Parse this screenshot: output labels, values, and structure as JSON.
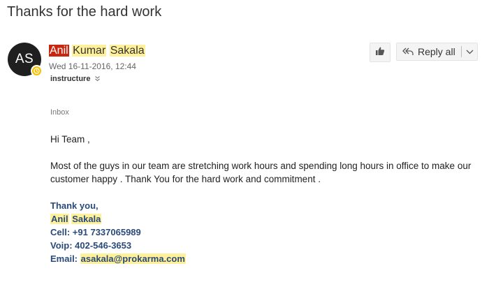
{
  "subject": "Thanks for the hard work",
  "avatar": {
    "initials": "AS",
    "presence_color": "#f8c200"
  },
  "sender": {
    "first": "Anil",
    "middle": "Kumar",
    "last": "Sakala"
  },
  "date": "Wed 16-11-2016, 12:44",
  "recipient": "instructure",
  "actions": {
    "like_icon": "thumbs-up-icon",
    "reply_all_label": "Reply all"
  },
  "folder": "Inbox",
  "message": {
    "greeting": "Hi Team ,",
    "body": "Most of the guys in our team are stretching work hours and spending long hours in office to make our customer happy . Thank You for the hard work and commitment ."
  },
  "signature": {
    "closing": "Thank you,",
    "name_first": "Anil",
    "name_last": "Sakala",
    "cell_label": "Cell:",
    "cell": "+91 7337065989",
    "voip_label": "Voip:",
    "voip": "402-546-3653",
    "email_label": "Email:",
    "email": "asakala@prokarma.com"
  },
  "colors": {
    "highlight_red": "#c9260f",
    "highlight_yellow": "#fff09a",
    "signature_blue": "#2a4a7a"
  }
}
